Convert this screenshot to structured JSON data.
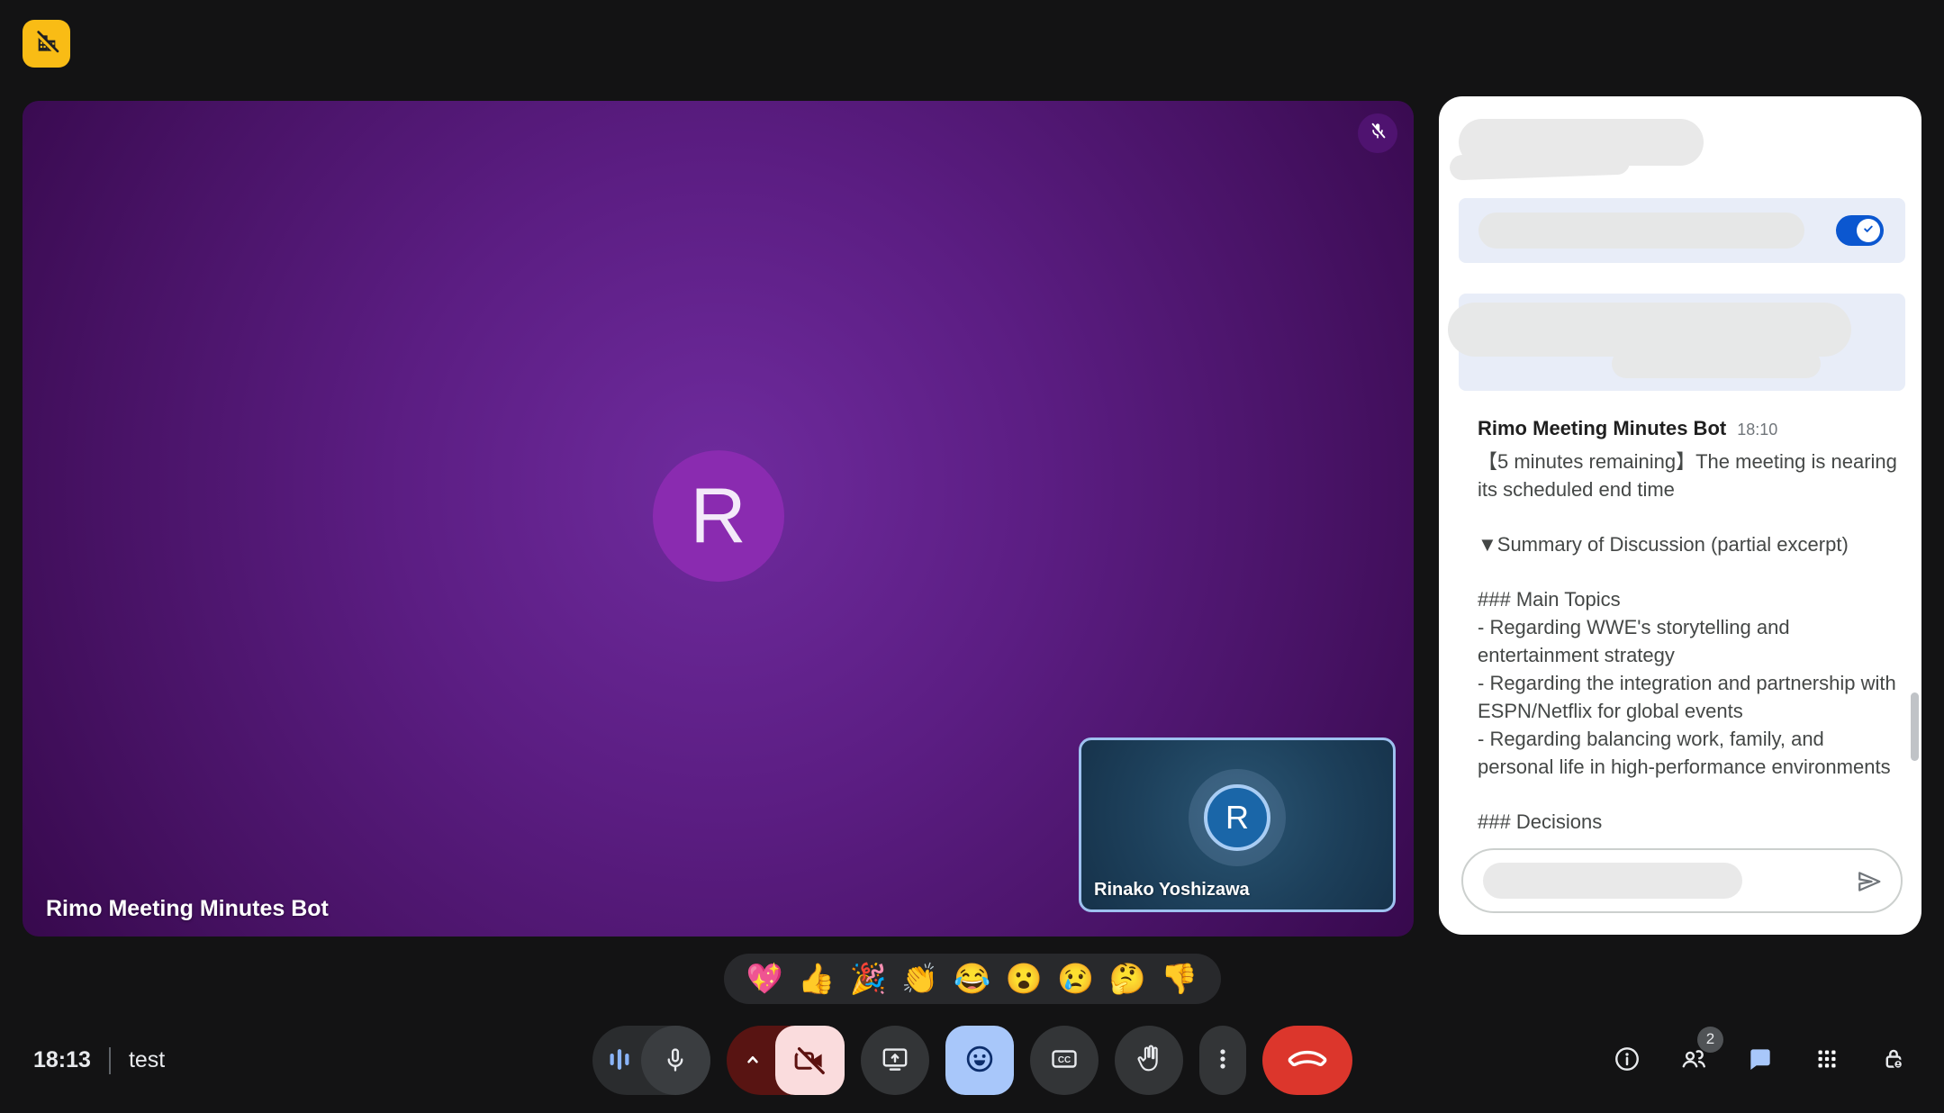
{
  "app_badge": {
    "icon": "companion-mode-off-icon",
    "color": "#f9bc15"
  },
  "main_tile": {
    "name": "Rimo Meeting Minutes Bot",
    "avatar_letter": "R",
    "mic_muted": true
  },
  "pip_tile": {
    "name": "Rinako Yoshizawa",
    "avatar_letter": "R",
    "speaking_border": "#9ec1ef"
  },
  "chat_panel": {
    "close_icon": "close-icon",
    "toggle": {
      "checked": true,
      "color": "#0b57d0",
      "check_icon": "checkmark-icon"
    },
    "redacted": {
      "title": true,
      "toggle_label": true,
      "notice": true,
      "input_text": true
    },
    "message": {
      "sender": "Rimo Meeting Minutes Bot",
      "time": "18:10",
      "paragraphs": [
        "【5 minutes remaining】The meeting is nearing its scheduled end time",
        "▼Summary of Discussion (partial excerpt)",
        "### Main Topics\n- Regarding WWE's storytelling and entertainment strategy\n- Regarding the integration and partnership with ESPN/Netflix for global events\n- Regarding balancing work, family, and personal life in high-performance environments",
        "### Decisions"
      ]
    },
    "input": {
      "value": "",
      "send_icon": "send-icon"
    }
  },
  "reactions_bar": {
    "emojis": [
      "💖",
      "👍",
      "🎉",
      "👏",
      "😂",
      "😮",
      "😢",
      "🤔",
      "👎"
    ]
  },
  "toolbar": {
    "captions_label": "CC",
    "buttons": [
      "audio-level",
      "microphone",
      "camera-options-chevron",
      "camera-off",
      "present-screen",
      "reactions",
      "captions",
      "raise-hand",
      "more-options",
      "end-call"
    ],
    "states": {
      "camera_off": true,
      "reactions_active": true
    },
    "colors": {
      "end_call_red": "#dc362c",
      "camera_off_pink": "#fadcdd",
      "camera_off_maroon": "#581412",
      "active_blue": "#a8c7fa",
      "waveform_blue": "#8ab4f8"
    }
  },
  "footer": {
    "clock": "18:13",
    "meeting_name": "test"
  },
  "footer_right": {
    "participants_count": "2",
    "icons": [
      "info-icon",
      "people-icon",
      "chat-icon",
      "apps-grid-icon",
      "host-controls-lock-icon"
    ],
    "chat_active": true
  },
  "colors": {
    "background": "#131314",
    "tile_purple": "#5b1d82",
    "avatar_purple": "#8a2bb0",
    "pip_blue": "#1a66a8",
    "panel_white": "#ffffff",
    "row_blue": "#e8edf8",
    "accent_blue": "#0b57d0"
  }
}
